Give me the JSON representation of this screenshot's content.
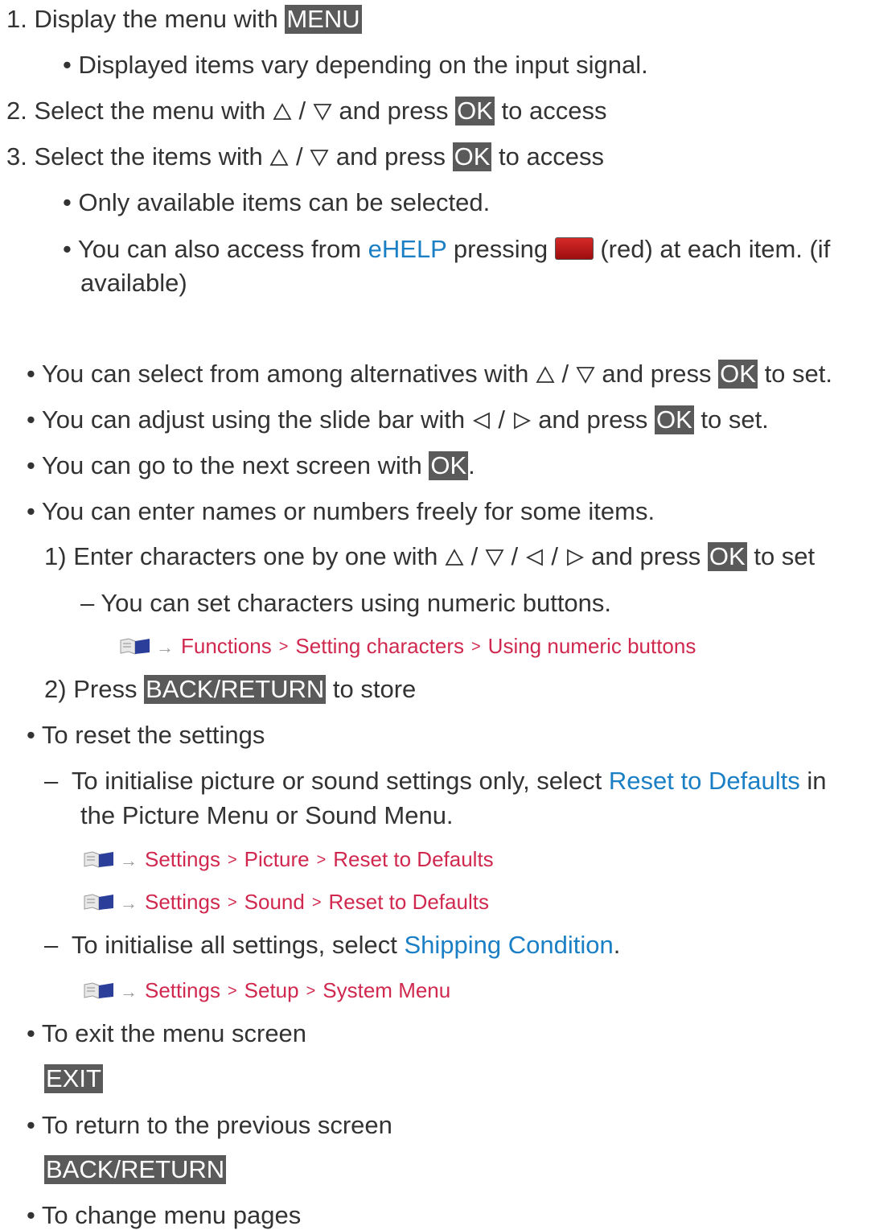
{
  "steps": [
    {
      "num": "1.",
      "pre": "Display the menu with ",
      "key": "MENU"
    },
    {
      "num": "2.",
      "pre": "Select the menu with ",
      "slash": " / ",
      "mid": " and press ",
      "key": "OK",
      "post": " to access"
    },
    {
      "num": "3.",
      "pre": "Select the items with ",
      "slash": " / ",
      "mid": " and press ",
      "key": "OK",
      "post": " to access"
    }
  ],
  "step1_note": "Displayed items vary depending on the input signal.",
  "step3_notes": {
    "only_available": "Only available items can be selected.",
    "ehelp_pre": "You can also access from ",
    "ehelp_link": "eHELP",
    "ehelp_mid": " pressing ",
    "ehelp_post": " (red) at each item. (if",
    "ehelp_cont": "available)"
  },
  "bullets": {
    "alternatives_pre": "You can select from among alternatives with ",
    "alternatives_slash": " / ",
    "alternatives_mid": " and press ",
    "alternatives_key": "OK",
    "alternatives_post": " to set.",
    "slide_pre": "You can adjust using the slide bar with ",
    "slide_slash": " / ",
    "slide_mid": " and press ",
    "slide_key": "OK",
    "slide_post": " to set.",
    "next_pre": "You can go to the next screen with ",
    "next_key": "OK",
    "next_post": ".",
    "names": "You can enter names or numbers freely for some items.",
    "enter_num": "1)",
    "enter_pre": "Enter characters one by one with ",
    "enter_slash": " / ",
    "enter_mid": " and press ",
    "enter_key": "OK",
    "enter_post": " to set",
    "numeric_note": "You can set characters using numeric buttons.",
    "press_num": "2)",
    "press_pre": "Press ",
    "press_key": "BACK/RETURN",
    "press_post": " to store",
    "reset_title": "To reset the settings",
    "reset_pre": "To initialise picture or sound settings only, select ",
    "reset_link": "Reset to Defaults",
    "reset_post": " in",
    "reset_cont": "the Picture Menu or Sound Menu.",
    "all_pre": "To initialise all settings, select ",
    "all_link": "Shipping Condition",
    "all_post": ".",
    "exit_title": "To exit the menu screen",
    "exit_key": "EXIT",
    "return_title": "To return to the previous screen",
    "return_key": "BACK/RETURN",
    "pages_title": "To change menu pages"
  },
  "bullet_char": "•",
  "dash_char": "–",
  "crumb_arrow": "→",
  "crumb_sep": ">",
  "paths": {
    "functions": [
      "Functions",
      "Setting characters",
      "Using numeric buttons"
    ],
    "picture": [
      "Settings",
      "Picture",
      "Reset to Defaults"
    ],
    "sound": [
      "Settings",
      "Sound",
      "Reset to Defaults"
    ],
    "system": [
      "Settings",
      "Setup",
      "System Menu"
    ]
  },
  "colors": {
    "key_bg": "#5a5a5a",
    "link": "#1a7fc4",
    "path": "#d0284e",
    "red_button": "#b81a1a"
  },
  "icons": {
    "up": "up-triangle-icon",
    "down": "down-triangle-icon",
    "left": "left-triangle-icon",
    "right": "right-triangle-icon",
    "book": "ehelp-book-icon"
  }
}
